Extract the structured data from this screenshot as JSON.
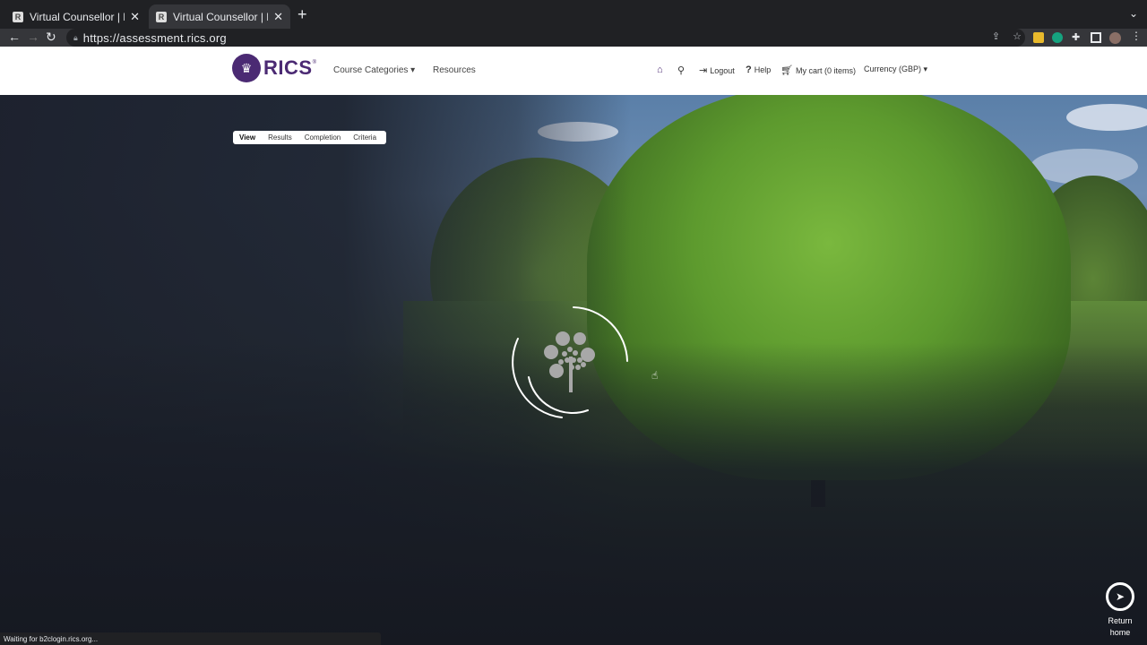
{
  "browser": {
    "tabs": [
      {
        "title": "Virtual Counsellor | RICS Online",
        "active": false
      },
      {
        "title": "Virtual Counsellor | RICS Online",
        "active": true
      }
    ],
    "new_tab": "+",
    "url": "https://assessment.rics.org",
    "status": "Waiting for b2clogin.rics.org..."
  },
  "site": {
    "logo_text": "RICS",
    "logo_reg": "®",
    "nav": [
      {
        "label": "Course Categories ▾"
      },
      {
        "label": "Resources"
      }
    ],
    "top_links": [
      {
        "icon": "home-icon",
        "label": ""
      },
      {
        "icon": "search-icon",
        "label": ""
      },
      {
        "icon": "logout-icon",
        "label": "Logout"
      },
      {
        "icon": "help-icon",
        "label": "Help"
      },
      {
        "icon": "cart-icon",
        "label": "My cart (0 items)"
      },
      {
        "icon": "",
        "label": "Currency (GBP) ▾"
      }
    ]
  },
  "subtabs": [
    {
      "label": "View",
      "selected": true
    },
    {
      "label": "Results",
      "selected": false
    },
    {
      "label": "Completion",
      "selected": false
    },
    {
      "label": "Criteria",
      "selected": false
    }
  ],
  "return_home": {
    "line1": "Return",
    "line2": "home"
  },
  "colors": {
    "brand": "#4b2a73"
  }
}
